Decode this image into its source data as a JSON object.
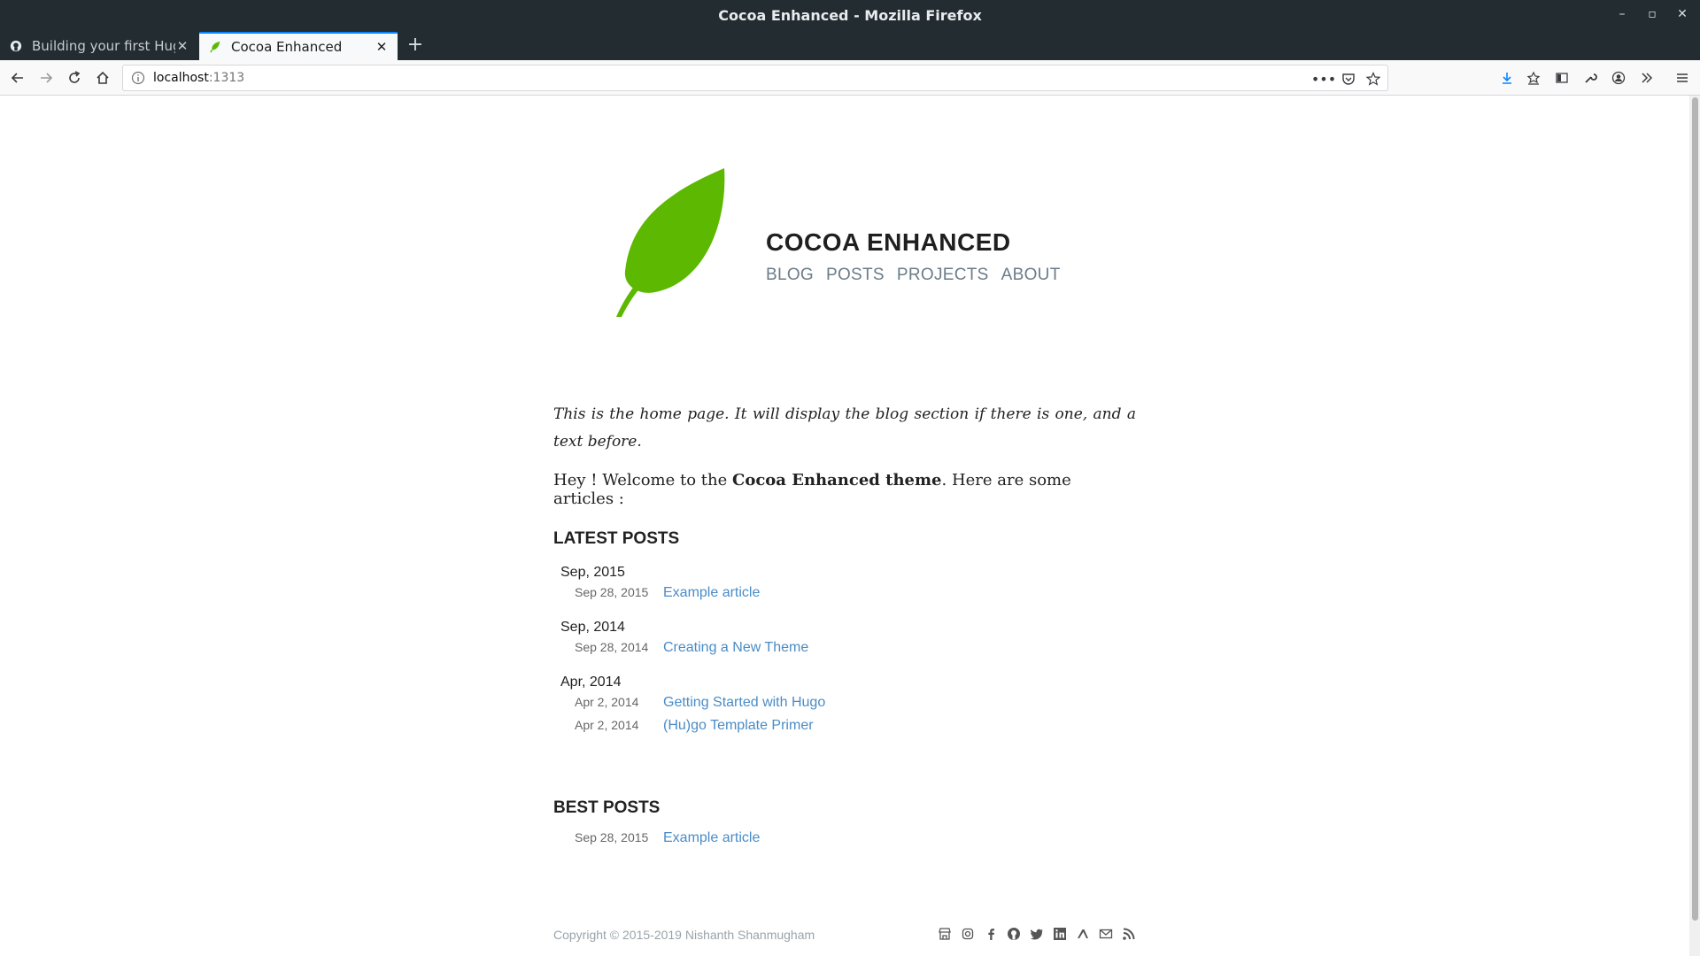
{
  "window": {
    "title": "Cocoa Enhanced - Mozilla Firefox"
  },
  "tabs": [
    {
      "label": "Building your first Hugo",
      "icon": "octocat-icon",
      "active": false
    },
    {
      "label": "Cocoa Enhanced",
      "icon": "leaf-icon",
      "active": true
    }
  ],
  "navbar": {
    "url_host": "localhost",
    "url_port": ":1313"
  },
  "site": {
    "title": "COCOA ENHANCED",
    "nav": [
      "BLOG",
      "POSTS",
      "PROJECTS",
      "ABOUT"
    ],
    "brand_color": "#5cb800"
  },
  "main": {
    "intro": "This is the home page. It will display the blog section if there is one, and a text before.",
    "welcome_pre": "Hey ! Welcome to the ",
    "welcome_bold": "Cocoa Enhanced theme",
    "welcome_post": ". Here are some articles :",
    "latest_title": "LATEST POSTS",
    "groups": [
      {
        "month": "Sep, 2015",
        "posts": [
          {
            "date": "Sep 28, 2015",
            "title": "Example article"
          }
        ]
      },
      {
        "month": "Sep, 2014",
        "posts": [
          {
            "date": "Sep 28, 2014",
            "title": "Creating a New Theme"
          }
        ]
      },
      {
        "month": "Apr, 2014",
        "posts": [
          {
            "date": "Apr 2, 2014",
            "title": "Getting Started with Hugo"
          },
          {
            "date": "Apr 2, 2014",
            "title": "(Hu)go Template Primer"
          }
        ]
      }
    ],
    "best_title": "BEST POSTS",
    "best_posts": [
      {
        "date": "Sep 28, 2015",
        "title": "Example article"
      }
    ]
  },
  "footer": {
    "copyright": "Copyright © 2015-2019 Nishanth Shanmugham",
    "social_icons": [
      "shop-icon",
      "instagram-icon",
      "facebook-icon",
      "github-icon",
      "twitter-icon",
      "linkedin-icon",
      "xing-icon",
      "email-icon",
      "rss-icon"
    ]
  },
  "colors": {
    "link": "#4a8cc7",
    "nav": "#6b7c89",
    "chrome": "#232c31",
    "accent": "#0a84ff"
  }
}
